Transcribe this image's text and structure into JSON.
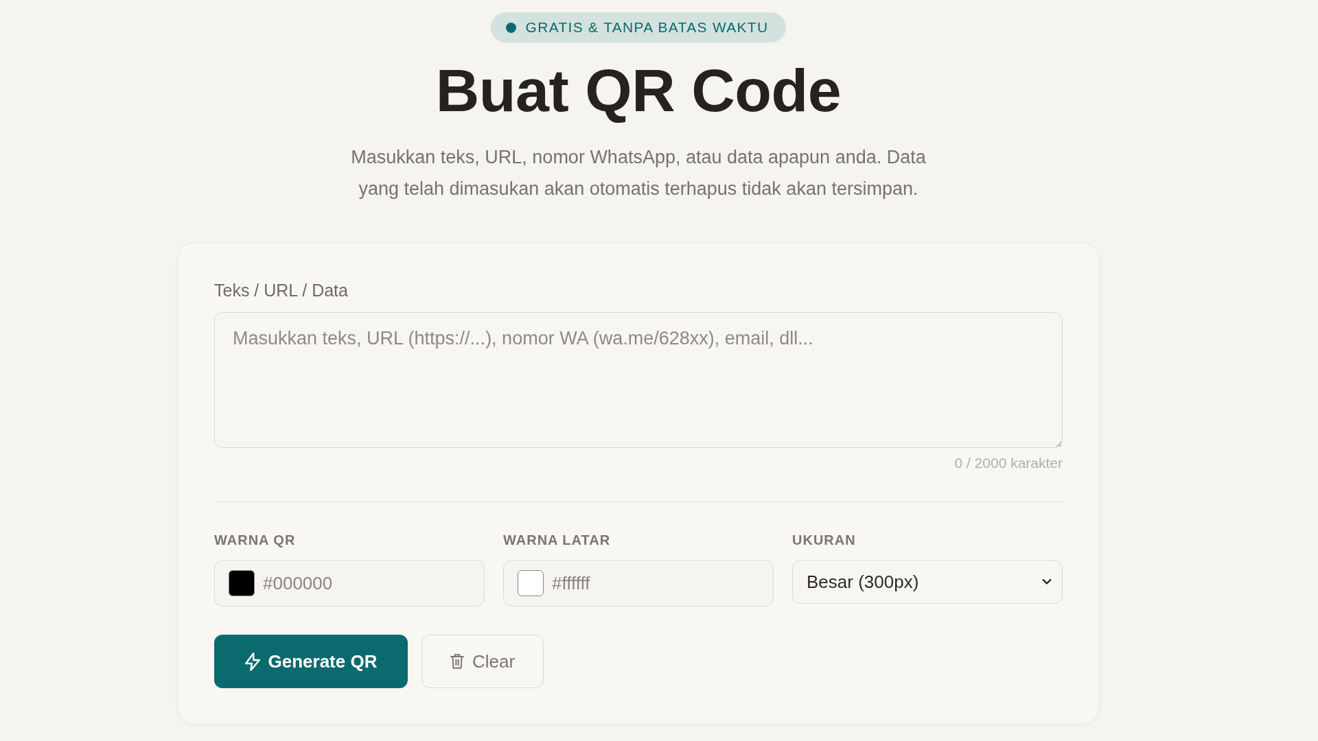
{
  "badge": {
    "text": "GRATIS & TANPA BATAS WAKTU"
  },
  "title": "Buat QR Code",
  "subtitle": "Masukkan teks, URL, nomor WhatsApp, atau data apapun anda. Data yang telah dimasukan akan otomatis terhapus tidak akan tersimpan.",
  "form": {
    "data_field": {
      "label": "Teks / URL / Data",
      "placeholder": "Masukkan teks, URL (https://...), nomor WA (wa.me/628xx), email, dll...",
      "counter": "0 / 2000 karakter"
    },
    "options": [
      {
        "kind": "color",
        "label": "WARNA QR",
        "value": "#000000",
        "color": "#000000"
      },
      {
        "kind": "color",
        "label": "WARNA LATAR",
        "value": "#ffffff",
        "color": "#ffffff"
      },
      {
        "kind": "select",
        "label": "UKURAN",
        "value": "Besar (300px)"
      }
    ],
    "buttons": [
      {
        "kind": "primary",
        "label": "Generate QR"
      },
      {
        "kind": "secondary",
        "label": "Clear"
      }
    ]
  }
}
